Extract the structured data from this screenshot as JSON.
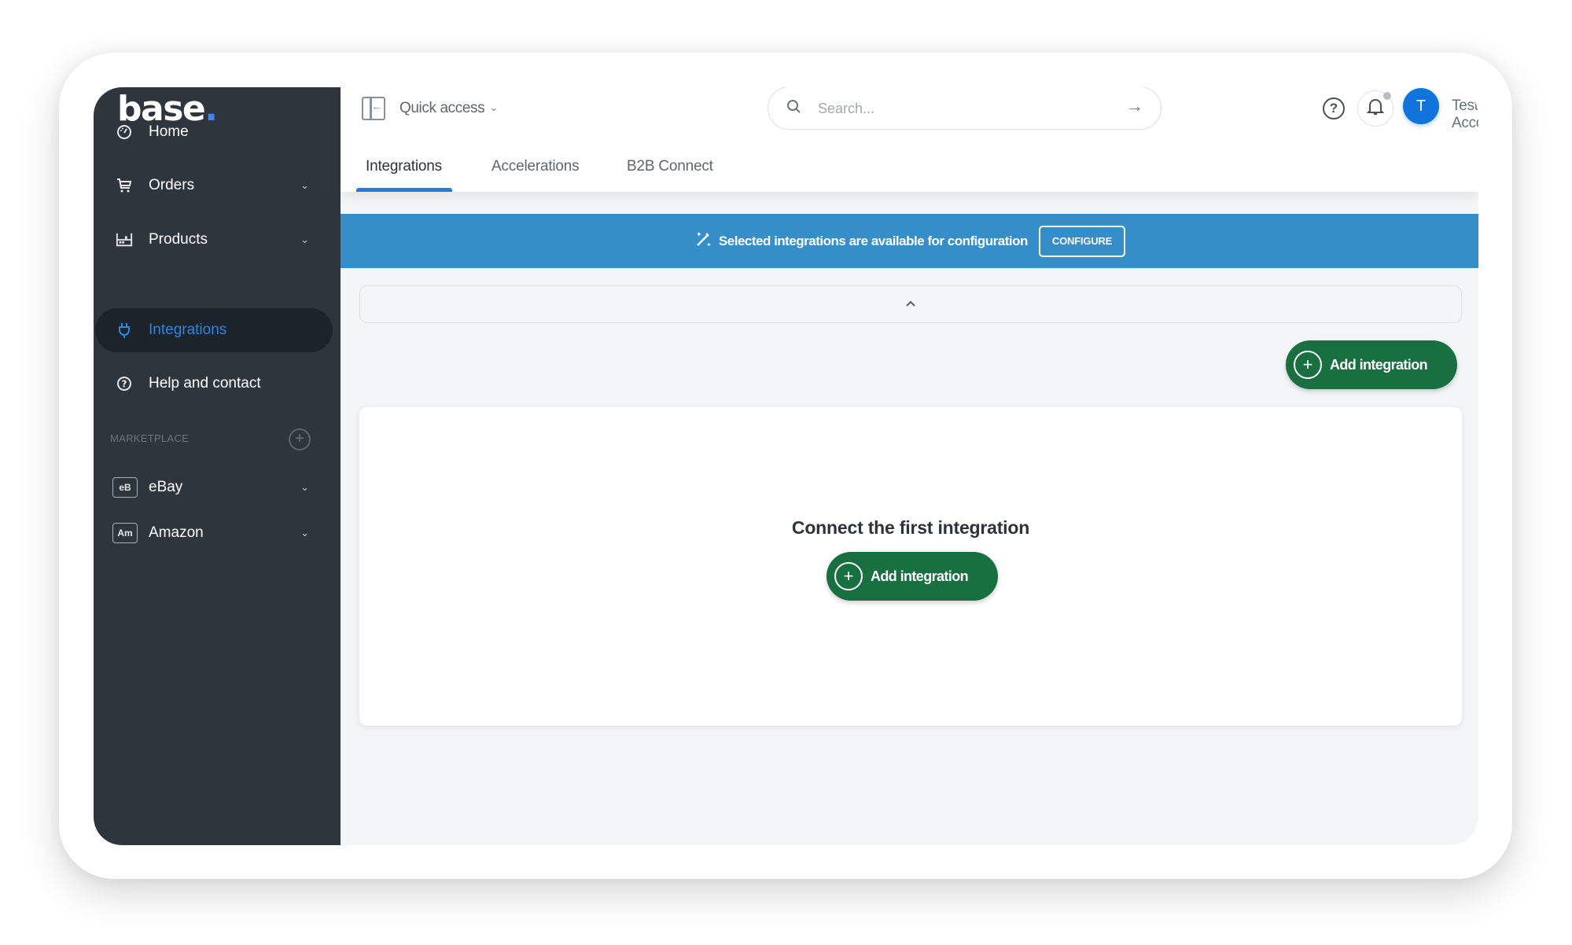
{
  "brand": {
    "name": "base",
    "dot": ".",
    "accent_color": "#3d86f2"
  },
  "sidebar": {
    "items": [
      {
        "label": "Home",
        "icon": "dashboard-gauge-icon",
        "has_chevron": false,
        "active": false
      },
      {
        "label": "Orders",
        "icon": "cart-icon",
        "has_chevron": true,
        "active": false
      },
      {
        "label": "Products",
        "icon": "warehouse-shelf-icon",
        "has_chevron": true,
        "active": false
      },
      {
        "label": "Integrations",
        "icon": "plug-icon",
        "has_chevron": false,
        "active": true
      },
      {
        "label": "Help and contact",
        "icon": "help-circle-icon",
        "has_chevron": false,
        "active": false
      }
    ],
    "marketplace": {
      "label": "MARKETPLACE",
      "add_icon": "plus-circle-icon",
      "items": [
        {
          "badge": "eB",
          "label": "eBay"
        },
        {
          "badge": "Am",
          "label": "Amazon"
        }
      ]
    }
  },
  "header": {
    "quick_access": {
      "label": "Quick access",
      "icon": "panel-collapse-icon"
    },
    "search": {
      "placeholder": "Search...",
      "value": "",
      "submit_icon": "arrow-right-icon"
    },
    "help_icon": "question-circle-icon",
    "notifications_icon": "bell-icon",
    "account": {
      "initial": "T",
      "name": "Test Account"
    },
    "tabs": [
      {
        "label": "Integrations",
        "active": true
      },
      {
        "label": "Accelerations",
        "active": false
      },
      {
        "label": "B2B Connect",
        "active": false
      }
    ]
  },
  "banner": {
    "icon": "magic-wand-icon",
    "message": "Selected integrations are available for configuration",
    "button_label": "CONFIGURE",
    "color": "#358ec8"
  },
  "filters_panel": {
    "toggle_icon": "chevron-up-icon"
  },
  "actions": {
    "add_integration_label": "Add integration",
    "button_color": "#186f3f"
  },
  "empty_state": {
    "title": "Connect the first integration",
    "button_label": "Add integration"
  }
}
